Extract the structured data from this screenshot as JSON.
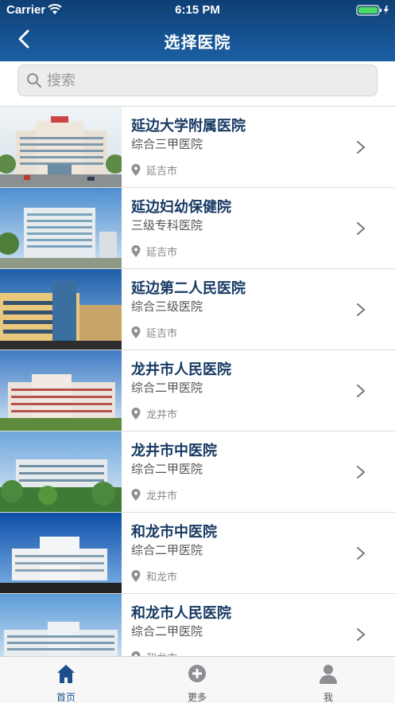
{
  "status_bar": {
    "carrier": "Carrier",
    "time": "6:15 PM"
  },
  "nav": {
    "title": "选择医院"
  },
  "search": {
    "placeholder": "搜索"
  },
  "hospitals": [
    {
      "name": "延边大学附属医院",
      "level": "综合三甲医院",
      "city": "延吉市"
    },
    {
      "name": "延边妇幼保健院",
      "level": "三级专科医院",
      "city": "延吉市"
    },
    {
      "name": "延边第二人民医院",
      "level": "综合三级医院",
      "city": "延吉市"
    },
    {
      "name": "龙井市人民医院",
      "level": "综合二甲医院",
      "city": "龙井市"
    },
    {
      "name": "龙井市中医院",
      "level": "综合二甲医院",
      "city": "龙井市"
    },
    {
      "name": "和龙市中医院",
      "level": "综合二甲医院",
      "city": "和龙市"
    },
    {
      "name": "和龙市人民医院",
      "level": "综合二甲医院",
      "city": "和龙市"
    }
  ],
  "tabbar": {
    "tabs": [
      {
        "label": "首页",
        "icon": "home-icon",
        "active": true
      },
      {
        "label": "更多",
        "icon": "plus-circle-icon",
        "active": false
      },
      {
        "label": "我",
        "icon": "person-icon",
        "active": false
      }
    ]
  },
  "colors": {
    "nav_top": "#0e3f74",
    "nav_bottom": "#1b5fa4",
    "hospital_name": "#173a63",
    "tab_active": "#1d4f8f",
    "tab_inactive": "#8e8e93"
  }
}
